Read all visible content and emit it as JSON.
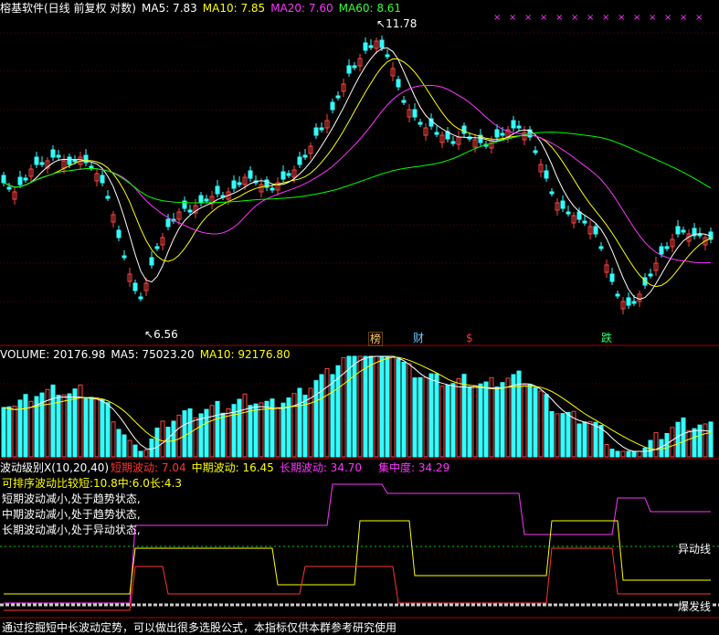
{
  "price_header": {
    "title": "榕基软件(日线 前复权 对数)",
    "ma5": "MA5: 7.83",
    "ma10": "MA10: 7.85",
    "ma20": "MA20: 7.60",
    "ma60": "MA60: 8.61",
    "colors": {
      "title": "#ffffff",
      "ma5": "#ffffff",
      "ma10": "#ffff00",
      "ma20": "#ff00ff",
      "ma60": "#00ff00"
    }
  },
  "price_annotations": {
    "high": "11.78",
    "low": "6.56"
  },
  "event_badges": [
    {
      "label": "榜",
      "color": "#ffcc66"
    },
    {
      "label": "财",
      "color": "#66ccff"
    },
    {
      "label": "$",
      "color": "#ff3333"
    },
    {
      "label": "跌",
      "color": "#33ff66"
    }
  ],
  "volume_header": {
    "volume": "VOLUME: 20176.98",
    "ma5": "MA5: 75023.20",
    "ma10": "MA10: 92176.80"
  },
  "wave_header": {
    "name": "波动级别X(10,20,40)",
    "short": "短期波动: 7.04",
    "mid": "中期波动: 16.45",
    "long": "长期波动: 34.70",
    "concentration": "集中度: 34.29"
  },
  "wave_notes": [
    "可排序波动比较短:10.8中:6.0长:4.3",
    "短期波动减小,处于趋势状态,",
    "中期波动减小,处于趋势状态,",
    "长期波动减小,处于异动状态,"
  ],
  "line_labels": {
    "abnormal": "异动线",
    "explosive": "爆发线"
  },
  "footer": "通过挖掘短中长波动定势，可以做出很多选股公式，本指标仅供本群参考研究使用",
  "chart_data": [
    {
      "type": "candlestick",
      "title": "榕基软件(日线 前复权 对数)",
      "annotations": {
        "max": 11.78,
        "min": 6.56
      },
      "series": [
        {
          "name": "MA5",
          "color": "#ffffff",
          "value": 7.83
        },
        {
          "name": "MA10",
          "color": "#ffff00",
          "value": 7.85
        },
        {
          "name": "MA20",
          "color": "#ff00ff",
          "value": 7.6
        },
        {
          "name": "MA60",
          "color": "#00ff00",
          "value": 8.61
        }
      ]
    },
    {
      "type": "bar",
      "title": "VOLUME",
      "series": [
        {
          "name": "VOLUME",
          "value": 20176.98
        },
        {
          "name": "MA5",
          "value": 75023.2
        },
        {
          "name": "MA10",
          "value": 92176.8
        }
      ]
    },
    {
      "type": "line",
      "title": "波动级别X(10,20,40)",
      "series": [
        {
          "name": "短期波动",
          "value": 7.04,
          "color": "#ff3333"
        },
        {
          "name": "中期波动",
          "value": 16.45,
          "color": "#ffff00"
        },
        {
          "name": "长期波动",
          "value": 34.7,
          "color": "#ff33ff"
        },
        {
          "name": "集中度",
          "value": 34.29
        }
      ]
    }
  ]
}
